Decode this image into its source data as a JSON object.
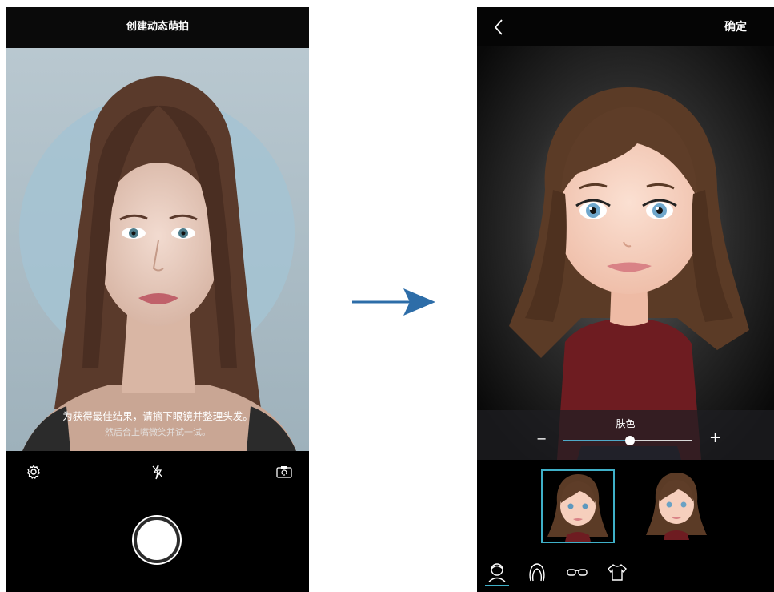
{
  "left_screen": {
    "title": "创建动态萌拍",
    "hint_line1": "为获得最佳结果，请摘下眼镜并整理头发。",
    "hint_line2": "然后合上嘴微笑并试一试。",
    "icons": [
      "settings-icon",
      "flash-off-icon",
      "switch-camera-icon"
    ],
    "shutter": "shutter-button"
  },
  "right_screen": {
    "confirm_label": "确定",
    "slider": {
      "label": "肤色",
      "minus": "−",
      "plus": "+",
      "value": 0.52
    },
    "thumbnails": [
      "avatar-option-1",
      "avatar-option-2"
    ],
    "selected_thumbnail": 0,
    "tabs": [
      "face-tab",
      "hair-tab",
      "glasses-tab",
      "clothes-tab"
    ],
    "selected_tab": 0
  },
  "colors": {
    "accent": "#3fb0c8",
    "arrow": "#2d6da8"
  }
}
